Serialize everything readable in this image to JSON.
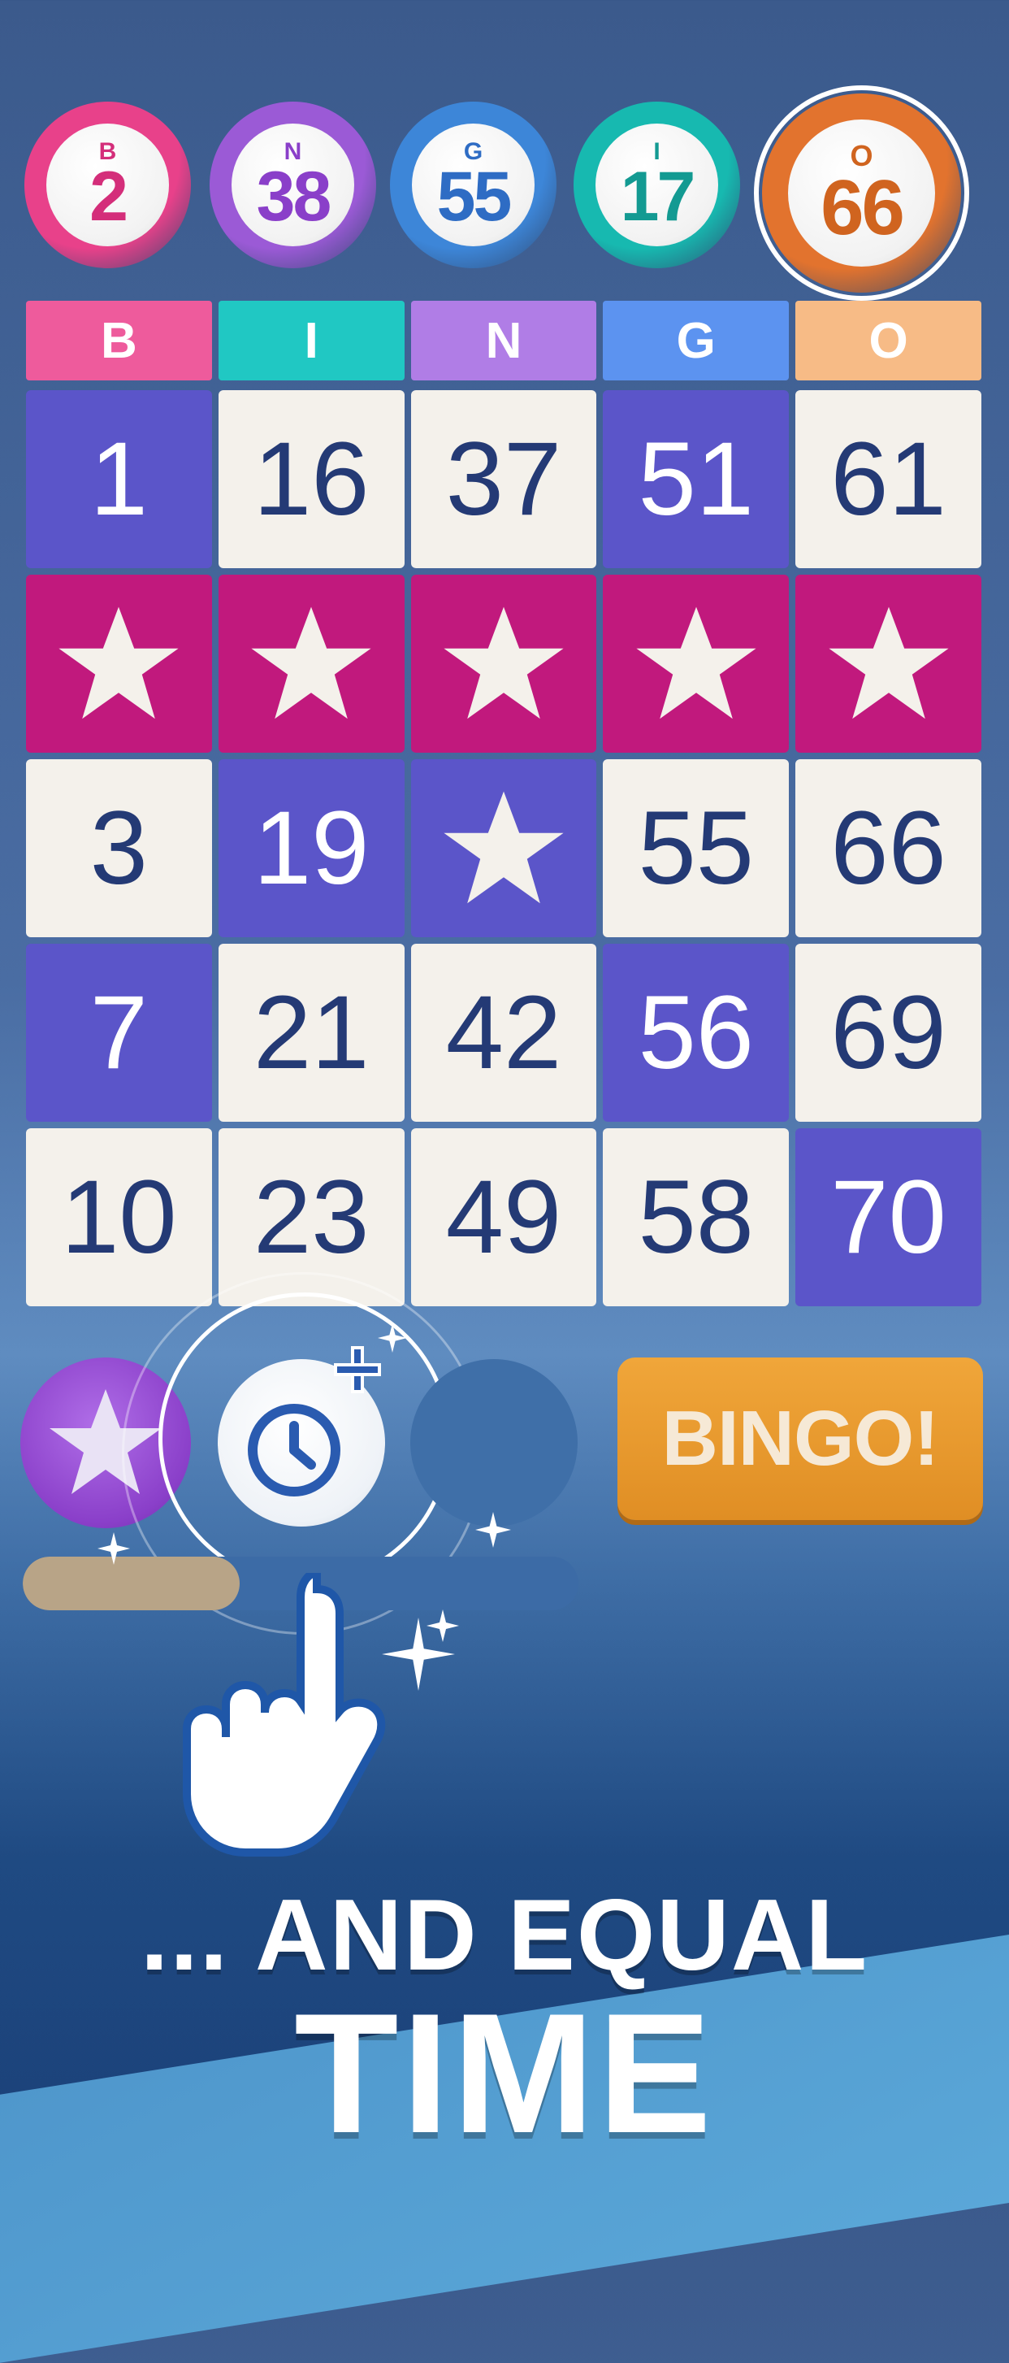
{
  "called_balls": [
    {
      "letter": "B",
      "number": "2",
      "color": "#e8418a",
      "text_color": "#d42e7a"
    },
    {
      "letter": "N",
      "number": "38",
      "color": "#9b5ad6",
      "text_color": "#8a3fc9"
    },
    {
      "letter": "G",
      "number": "55",
      "color": "#3d86d8",
      "text_color": "#2e6cc4"
    },
    {
      "letter": "I",
      "number": "17",
      "color": "#17b9b0",
      "text_color": "#139a92"
    },
    {
      "letter": "O",
      "number": "66",
      "color": "#e2732e",
      "text_color": "#d0641f"
    }
  ],
  "card": {
    "headers": [
      {
        "label": "B",
        "color": "#ee5b9c"
      },
      {
        "label": "I",
        "color": "#20c8c3"
      },
      {
        "label": "N",
        "color": "#b07de6"
      },
      {
        "label": "G",
        "color": "#5c93f0"
      },
      {
        "label": "O",
        "color": "#f7bb86"
      }
    ],
    "rows": [
      [
        {
          "value": "1",
          "state": "marked"
        },
        {
          "value": "16",
          "state": "open"
        },
        {
          "value": "37",
          "state": "open"
        },
        {
          "value": "51",
          "state": "marked"
        },
        {
          "value": "61",
          "state": "open"
        }
      ],
      [
        {
          "value": "",
          "state": "star-win"
        },
        {
          "value": "",
          "state": "star-win"
        },
        {
          "value": "",
          "state": "star-win"
        },
        {
          "value": "",
          "state": "star-win"
        },
        {
          "value": "",
          "state": "star-win"
        }
      ],
      [
        {
          "value": "3",
          "state": "open"
        },
        {
          "value": "19",
          "state": "marked"
        },
        {
          "value": "",
          "state": "star-free"
        },
        {
          "value": "55",
          "state": "open"
        },
        {
          "value": "66",
          "state": "open"
        }
      ],
      [
        {
          "value": "7",
          "state": "marked"
        },
        {
          "value": "21",
          "state": "open"
        },
        {
          "value": "42",
          "state": "open"
        },
        {
          "value": "56",
          "state": "marked"
        },
        {
          "value": "69",
          "state": "open"
        }
      ],
      [
        {
          "value": "10",
          "state": "open"
        },
        {
          "value": "23",
          "state": "open"
        },
        {
          "value": "49",
          "state": "open"
        },
        {
          "value": "58",
          "state": "open"
        },
        {
          "value": "70",
          "state": "marked"
        }
      ]
    ]
  },
  "powerups": {
    "star_icon": "star-powerup-icon",
    "time_icon": "clock-plus-icon",
    "progress": 0.39
  },
  "bingo_button": {
    "label": "BINGO!"
  },
  "caption": {
    "line1": "... AND EQUAL",
    "line2": "TIME"
  }
}
